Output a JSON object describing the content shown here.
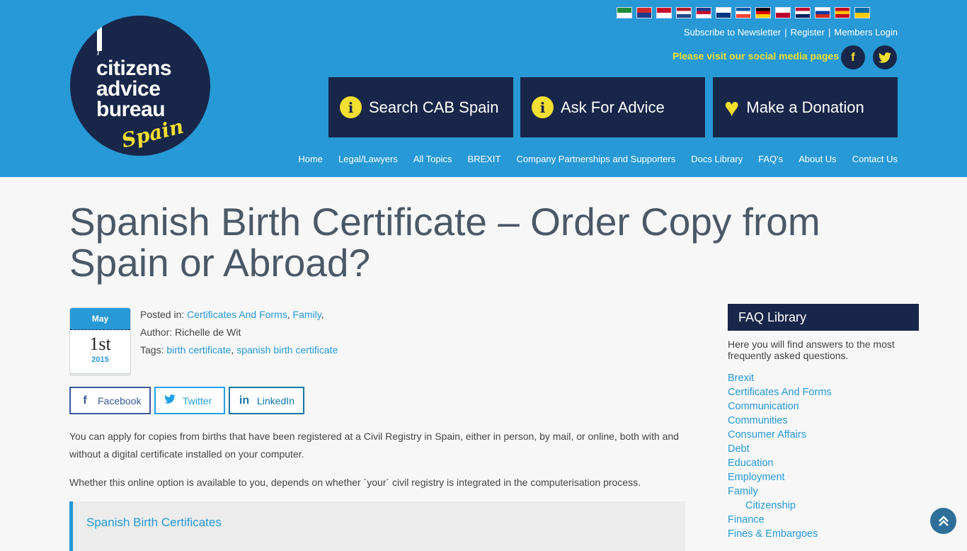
{
  "logo": {
    "i": "i",
    "line1": "citizens",
    "line2": "advice",
    "line3": "bureau",
    "spain": "Spain"
  },
  "flags": [
    {
      "name": "arabic-flag",
      "colors": [
        "#1c8c3c",
        "#ffffff"
      ]
    },
    {
      "name": "chinese-flag",
      "colors": [
        "#d22a2a",
        "#1b3c8c"
      ]
    },
    {
      "name": "danish-flag",
      "colors": [
        "#c8102e",
        "#ffffff"
      ]
    },
    {
      "name": "dutch-flag",
      "colors": [
        "#ae1c28",
        "#ffffff",
        "#21468b"
      ]
    },
    {
      "name": "english-flag",
      "colors": [
        "#1b3c8c",
        "#c8102e",
        "#ffffff"
      ]
    },
    {
      "name": "finnish-flag",
      "colors": [
        "#ffffff",
        "#003580"
      ]
    },
    {
      "name": "french-flag",
      "colors": [
        "#0055a4",
        "#ffffff",
        "#ef4135"
      ]
    },
    {
      "name": "german-flag",
      "colors": [
        "#000000",
        "#dd0000",
        "#ffce00"
      ]
    },
    {
      "name": "japanese-flag",
      "colors": [
        "#ffffff",
        "#bc002d"
      ]
    },
    {
      "name": "norwegian-flag",
      "colors": [
        "#ba0c2f",
        "#ffffff",
        "#00205b"
      ]
    },
    {
      "name": "russian-flag",
      "colors": [
        "#ffffff",
        "#0039a6",
        "#d52b1e"
      ]
    },
    {
      "name": "spanish-flag",
      "colors": [
        "#c60b1e",
        "#ffc400",
        "#c60b1e"
      ]
    },
    {
      "name": "swedish-flag",
      "colors": [
        "#006aa7",
        "#fecc00"
      ]
    }
  ],
  "toplinks": {
    "subscribe": "Subscribe to Newsletter",
    "register": "Register",
    "login": "Members Login",
    "sep": "|"
  },
  "social": {
    "text": "Please visit our social media pages",
    "facebook_glyph": "f",
    "twitter_glyph": "🐦"
  },
  "buttons": {
    "search": "Search CAB Spain",
    "advice": "Ask For Advice",
    "donate": "Make a Donation",
    "info_glyph": "i",
    "heart_glyph": "♥"
  },
  "nav": [
    "Home",
    "Legal/Lawyers",
    "All Topics",
    "BREXIT",
    "Company Partnerships and Supporters",
    "Docs Library",
    "FAQ's",
    "About Us",
    "Contact Us"
  ],
  "article": {
    "title": "Spanish Birth Certificate – Order Copy from Spain or Abroad?",
    "date": {
      "month": "May",
      "day": "1st",
      "year": "2015"
    },
    "posted_label": "Posted in: ",
    "categories": [
      "Certificates And Forms",
      "Family"
    ],
    "author": "Author: Richelle de Wit",
    "tags_label": "Tags: ",
    "tags": [
      "birth certificate",
      "spanish birth certificate"
    ],
    "share": {
      "facebook": "Facebook",
      "twitter": "Twitter",
      "linkedin": "LinkedIn"
    },
    "p1": "You can apply for copies from births that have been registered at a Civil Registry in Spain, either in person, by mail, or online, both with and without a digital certificate installed on your computer.",
    "p2": "Whether this online option is available to you, depends on whether ´your´ civil registry is integrated in the computerisation process.",
    "callout": "Spanish Birth Certificates"
  },
  "sidebar": {
    "title": "FAQ Library",
    "desc": "Here you will find answers to the most frequently asked questions.",
    "items": [
      {
        "label": "Brexit",
        "sub": false
      },
      {
        "label": "Certificates And Forms",
        "sub": false
      },
      {
        "label": "Communication",
        "sub": false
      },
      {
        "label": "Communities",
        "sub": false
      },
      {
        "label": "Consumer Affairs",
        "sub": false
      },
      {
        "label": "Debt",
        "sub": false
      },
      {
        "label": "Education",
        "sub": false
      },
      {
        "label": "Employment",
        "sub": false
      },
      {
        "label": "Family",
        "sub": false
      },
      {
        "label": "Citizenship",
        "sub": true
      },
      {
        "label": "Finance",
        "sub": false
      },
      {
        "label": "Fines & Embargoes",
        "sub": false
      }
    ]
  },
  "totop_glyph": "︽"
}
